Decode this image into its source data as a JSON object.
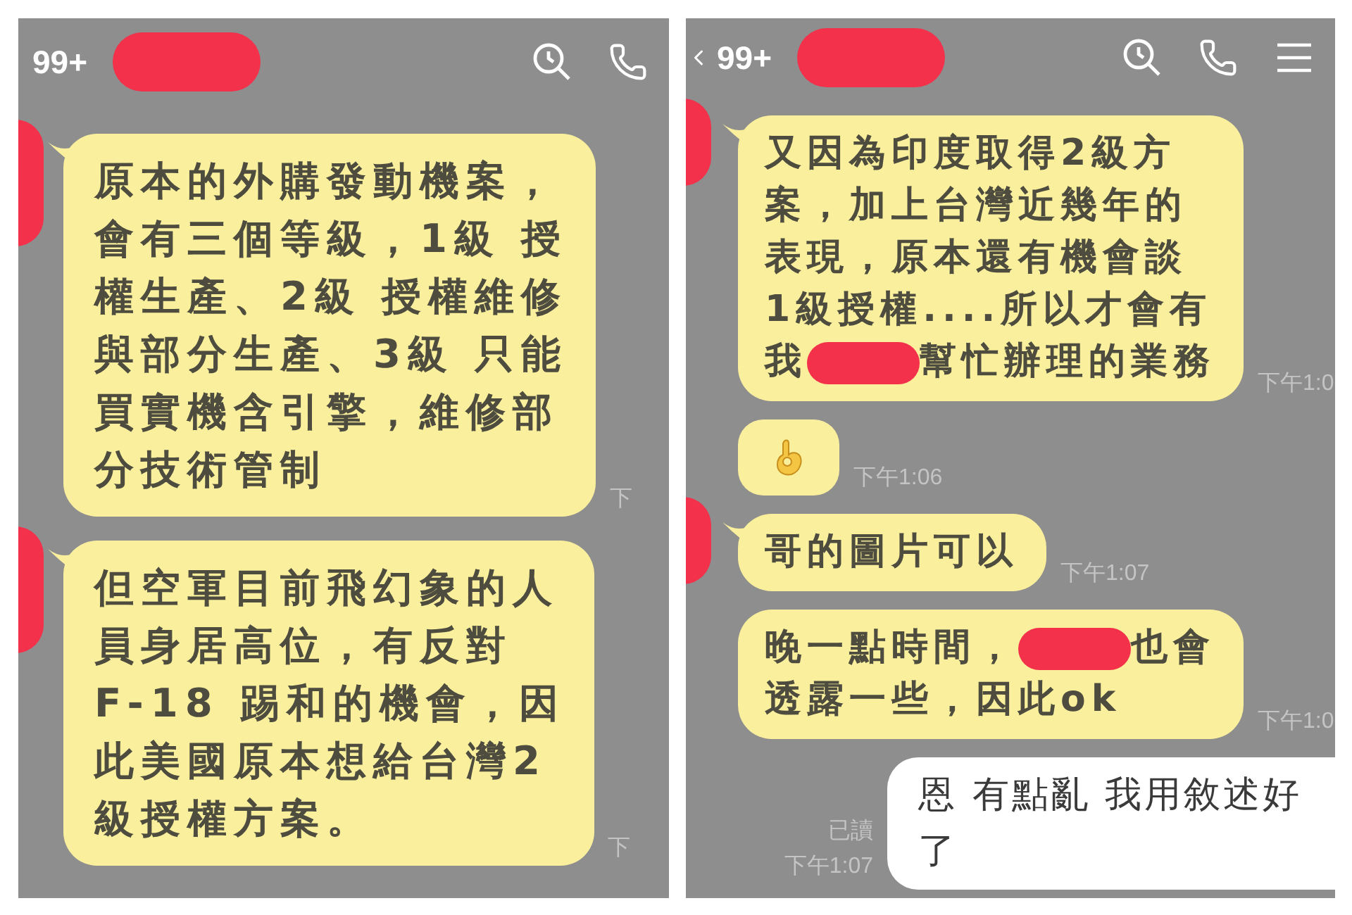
{
  "panels": [
    {
      "header": {
        "unread": "99+",
        "name_redacted": true,
        "icons": [
          {
            "kind": "search"
          },
          {
            "kind": "call"
          }
        ]
      },
      "messages": [
        {
          "kind": "incoming",
          "avatar_redacted": true,
          "time": "下",
          "lines": [
            [
              {
                "kind": "text",
                "text": "原本的外購發動機案，"
              }
            ],
            [
              {
                "kind": "text",
                "text": "會有三個等級，1級 授"
              }
            ],
            [
              {
                "kind": "text",
                "text": "權生產、2級 授權維修"
              }
            ],
            [
              {
                "kind": "text",
                "text": "與部分生產、3級 只能"
              }
            ],
            [
              {
                "kind": "text",
                "text": "買實機含引擎，維修部"
              }
            ],
            [
              {
                "kind": "text",
                "text": "分技術管制"
              }
            ]
          ]
        },
        {
          "kind": "incoming",
          "avatar_redacted": true,
          "time": "下",
          "lines": [
            [
              {
                "kind": "text",
                "text": "但空軍目前飛幻象的人"
              }
            ],
            [
              {
                "kind": "text",
                "text": "員身居高位，有反對"
              }
            ],
            [
              {
                "kind": "text",
                "text": "F-18 踢和的機會，因"
              }
            ],
            [
              {
                "kind": "text",
                "text": "此美國原本想給台灣2"
              }
            ],
            [
              {
                "kind": "text",
                "text": "級授權方案。"
              }
            ]
          ]
        }
      ]
    },
    {
      "header": {
        "leading_icons": [
          {
            "kind": "back"
          }
        ],
        "unread": "99+",
        "name_redacted": true,
        "icons": [
          {
            "kind": "search"
          },
          {
            "kind": "call"
          },
          {
            "kind": "menu"
          }
        ]
      },
      "messages": [
        {
          "kind": "incoming",
          "avatar_redacted": true,
          "time": "下午1:0",
          "lines": [
            [
              {
                "kind": "text",
                "text": "又因為印度取得2級方"
              }
            ],
            [
              {
                "kind": "text",
                "text": "案，加上台灣近幾年的"
              }
            ],
            [
              {
                "kind": "text",
                "text": "表現，原本還有機會談"
              }
            ],
            [
              {
                "kind": "text",
                "text": "1級授權....所以才會有"
              }
            ],
            [
              {
                "kind": "text",
                "text": "我"
              },
              {
                "kind": "redaction"
              },
              {
                "kind": "text",
                "text": "幫忙辦理的業務"
              }
            ]
          ]
        },
        {
          "kind": "sticker",
          "time": "下午1:06"
        },
        {
          "kind": "incoming",
          "avatar_redacted": true,
          "time": "下午1:07",
          "lines": [
            [
              {
                "kind": "text",
                "text": "哥的圖片可以"
              }
            ]
          ]
        },
        {
          "kind": "incoming",
          "time": "下午1:0",
          "lines": [
            [
              {
                "kind": "text",
                "text": "晚一點時間，"
              },
              {
                "kind": "redaction"
              },
              {
                "kind": "text",
                "text": "也會"
              }
            ],
            [
              {
                "kind": "text",
                "text": "透露一些，因此ok"
              }
            ]
          ]
        },
        {
          "kind": "outgoing",
          "read": "已讀",
          "time": "下午1:07",
          "lines": [
            [
              {
                "kind": "text",
                "text": "恩 有點亂 我用敘述好"
              }
            ],
            [
              {
                "kind": "text",
                "text": "了"
              }
            ]
          ]
        }
      ]
    }
  ]
}
